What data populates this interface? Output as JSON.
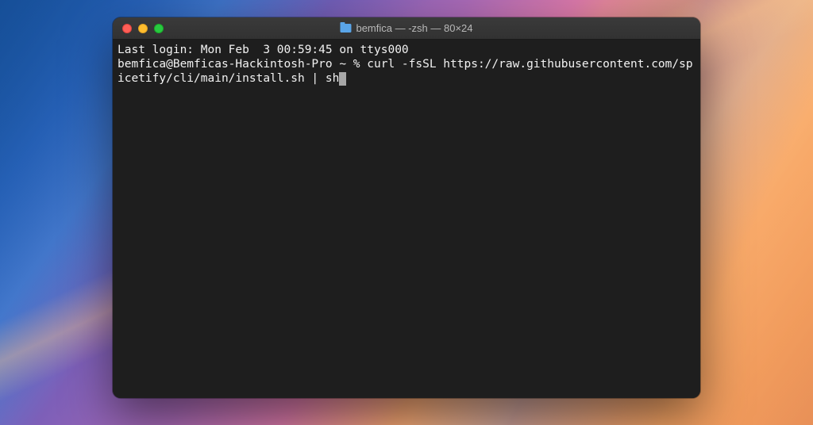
{
  "window": {
    "title": "bemfica — -zsh — 80×24"
  },
  "terminal": {
    "last_login": "Last login: Mon Feb  3 00:59:45 on ttys000",
    "prompt": "bemfica@Bemficas-Hackintosh-Pro ~ % ",
    "command": "curl -fsSL https://raw.githubusercontent.com/spicetify/cli/main/install.sh | sh"
  }
}
